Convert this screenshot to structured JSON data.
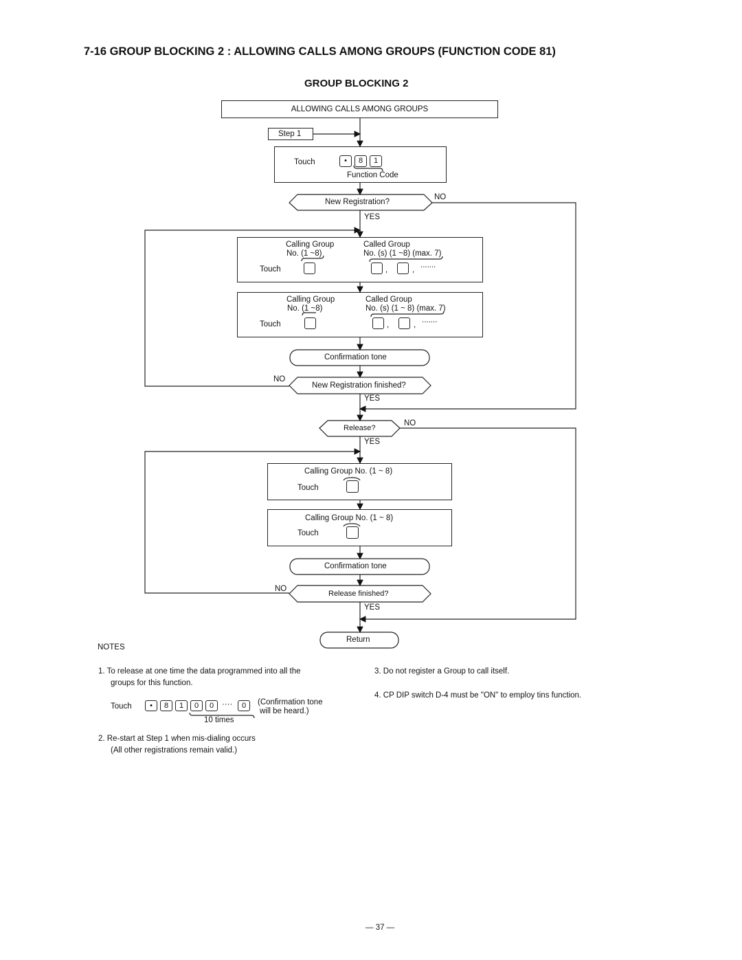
{
  "title": "7-16 GROUP BLOCKING 2 : ALLOWING CALLS AMONG GROUPS (FUNCTION CODE 81)",
  "subtitle": "GROUP BLOCKING 2",
  "flow": {
    "header": "ALLOWING CALLS AMONG GROUPS",
    "step": "Step 1",
    "touch": "Touch",
    "keys_fc": [
      "•",
      "8",
      "1"
    ],
    "function_code": "Function Code",
    "new_registration": "New Registration?",
    "yes": "YES",
    "no": "NO",
    "calling_group": "Calling Group",
    "calling_range": "No. (1 ~8)",
    "called_group": "Called Group",
    "called_range_1": "No. (s) (1 ~8) (max. 7)",
    "called_range_2": "No. (s) (1 ~ 8) (max. 7)",
    "comma": ",",
    "dots": ".......",
    "confirmation_tone": "Confirmation  tone",
    "new_registration_finished": "New Registration finished?",
    "release": "Release?",
    "calling_group_no": "Calling Group No. (1 ~ 8)",
    "release_finished": "Release finished?",
    "return": "Return"
  },
  "notes": {
    "heading": "NOTES",
    "n1_line1": "1.  To release at one time the data programmed into all the",
    "n1_line2": "groups for this function.",
    "n1_touch": "Touch",
    "n1_keys": [
      "•",
      "8",
      "1",
      "0",
      "0",
      "0"
    ],
    "n1_ellipsis": "····",
    "n1_times": "10 times",
    "n1_conf1": "(Confirmation tone",
    "n1_conf2": "will  be  heard.)",
    "n2_line1": "2.  Re-start at Step 1 when mis-dialing occurs",
    "n2_line2": "(All other registrations remain valid.)",
    "n3": "3.  Do not register a Group to call itself.",
    "n4": "4.  CP  DIP switch  D-4 must be \"ON\" to employ tins function."
  },
  "page_number": "— 37 —"
}
